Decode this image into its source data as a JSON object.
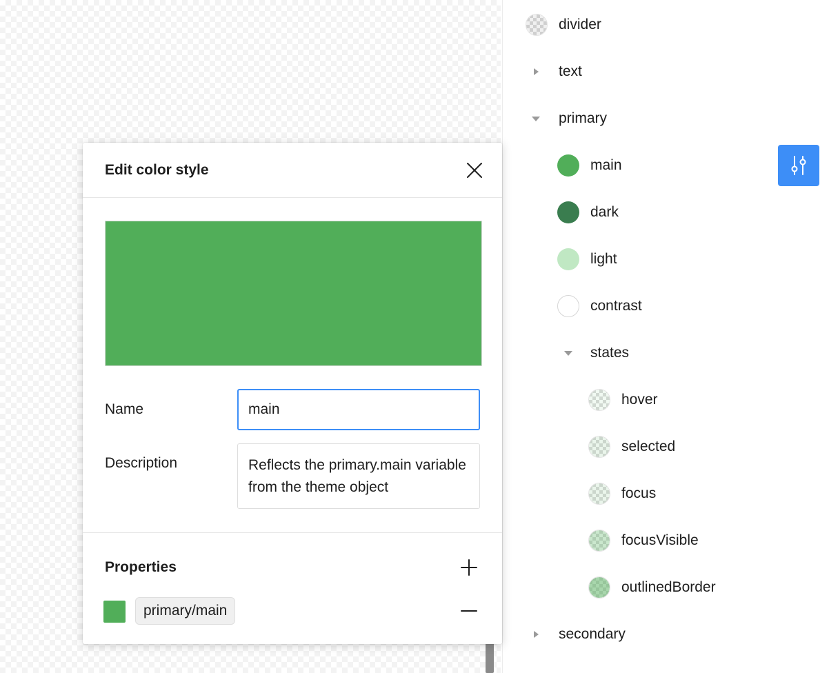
{
  "dialog": {
    "title": "Edit color style",
    "preview_color": "#51ae59",
    "name_label": "Name",
    "name_value": "main",
    "description_label": "Description",
    "description_value": "Reflects the primary.main variable from the theme object",
    "properties_title": "Properties",
    "property": {
      "label": "primary/main",
      "color": "#51ae59"
    }
  },
  "tree": {
    "divider": {
      "label": "divider",
      "icon": "checker-swatch"
    },
    "text": {
      "label": "text",
      "expanded": false
    },
    "primary": {
      "label": "primary",
      "expanded": true,
      "items": [
        {
          "label": "main",
          "color": "#51ae59"
        },
        {
          "label": "dark",
          "color": "#3a7d4f"
        },
        {
          "label": "light",
          "color": "#c0e8c3"
        },
        {
          "label": "contrast",
          "color": "#ffffff"
        }
      ],
      "states": {
        "label": "states",
        "expanded": true,
        "items": [
          {
            "label": "hover",
            "color": "#51ae59",
            "opacity": 0.08
          },
          {
            "label": "selected",
            "color": "#51ae59",
            "opacity": 0.12
          },
          {
            "label": "focus",
            "color": "#51ae59",
            "opacity": 0.12
          },
          {
            "label": "focusVisible",
            "color": "#51ae59",
            "opacity": 0.3
          },
          {
            "label": "outlinedBorder",
            "color": "#51ae59",
            "opacity": 0.5
          }
        ]
      }
    },
    "secondary": {
      "label": "secondary",
      "expanded": false
    }
  },
  "colors": {
    "accent": "#3d8ef7"
  }
}
